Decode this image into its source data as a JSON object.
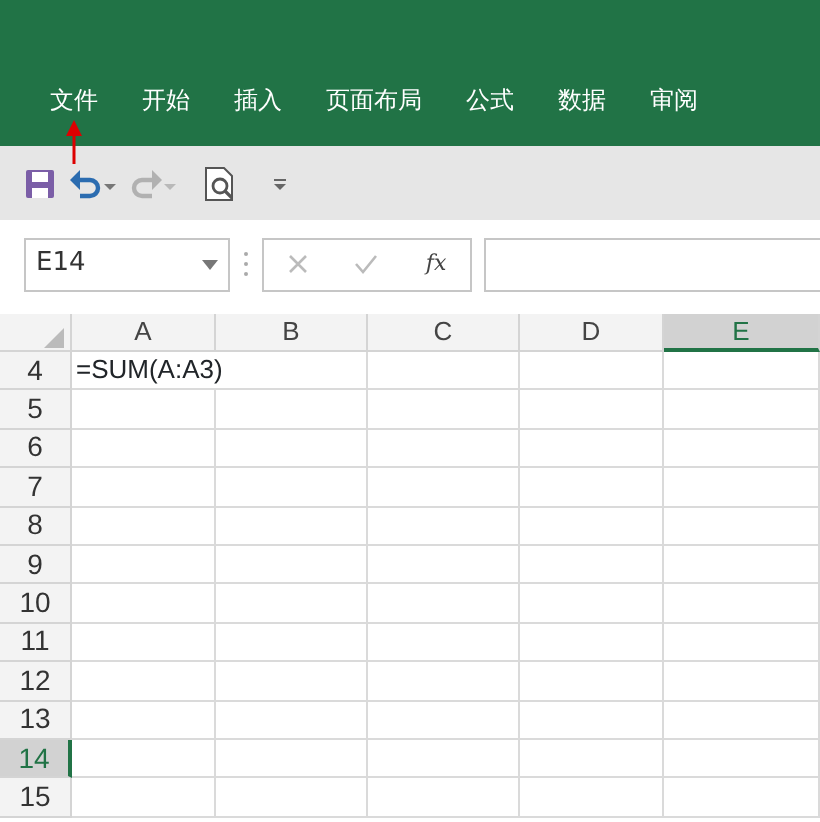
{
  "ribbon_tabs": [
    {
      "label": "文件",
      "selected": false
    },
    {
      "label": "开始",
      "selected": false
    },
    {
      "label": "插入",
      "selected": false
    },
    {
      "label": "页面布局",
      "selected": false
    },
    {
      "label": "公式",
      "selected": false
    },
    {
      "label": "数据",
      "selected": false
    },
    {
      "label": "审阅",
      "selected": false
    }
  ],
  "quick_access": [
    {
      "kind": "save",
      "disabled": false
    },
    {
      "kind": "undo",
      "disabled": false
    },
    {
      "kind": "redo",
      "disabled": true
    },
    {
      "kind": "preview",
      "disabled": false
    },
    {
      "kind": "customize",
      "disabled": false
    }
  ],
  "name_box": {
    "value": "E14"
  },
  "formula_bar": {
    "fx": "fx"
  },
  "columns": [
    {
      "label": "A",
      "selected": false
    },
    {
      "label": "B",
      "selected": false
    },
    {
      "label": "C",
      "selected": false
    },
    {
      "label": "D",
      "selected": false
    },
    {
      "label": "E",
      "selected": true
    }
  ],
  "rows": [
    {
      "label": "4",
      "selected": false,
      "cells": [
        "=SUM(A:A3)"
      ]
    },
    {
      "label": "5",
      "selected": false
    },
    {
      "label": "6",
      "selected": false
    },
    {
      "label": "7",
      "selected": false
    },
    {
      "label": "8",
      "selected": false
    },
    {
      "label": "9",
      "selected": false
    },
    {
      "label": "10",
      "selected": false
    },
    {
      "label": "11",
      "selected": false
    },
    {
      "label": "12",
      "selected": false
    },
    {
      "label": "13",
      "selected": false
    },
    {
      "label": "14",
      "selected": true
    },
    {
      "label": "15",
      "selected": false
    }
  ]
}
